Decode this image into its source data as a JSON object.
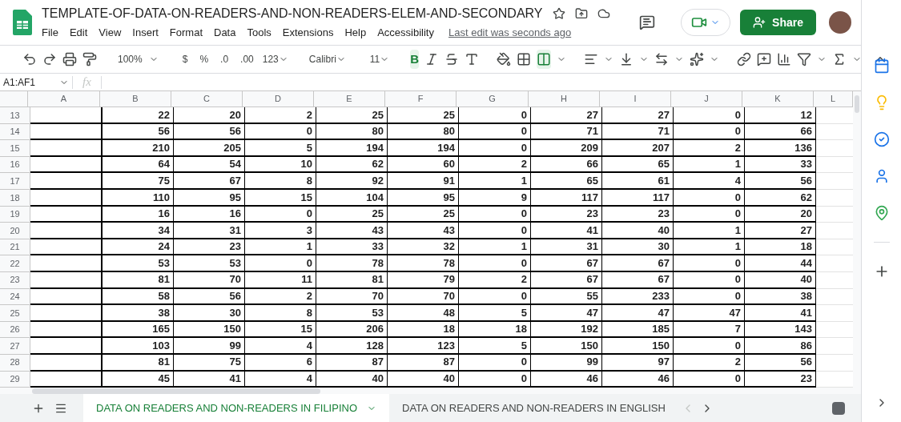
{
  "document": {
    "title": "TEMPLATE-OF-DATA-ON-READERS-AND-NON-READERS-ELEM-AND-SECONDARY",
    "last_edit": "Last edit was seconds ago",
    "share": "Share"
  },
  "menu": [
    "File",
    "Edit",
    "View",
    "Insert",
    "Format",
    "Data",
    "Tools",
    "Extensions",
    "Help",
    "Accessibility"
  ],
  "toolbar": {
    "zoom": "100%",
    "currency": "$",
    "percent": "%",
    "decrease_decimals": ".0",
    "increase_decimals": ".00",
    "number_format": "123",
    "font": "Calibri",
    "font_size": "11",
    "bold": "B",
    "bold_active": true,
    "merge_active": true
  },
  "formula_bar": {
    "name_box": "A1:AF1",
    "fx": "fx"
  },
  "columns": [
    "A",
    "B",
    "C",
    "D",
    "E",
    "F",
    "G",
    "H",
    "I",
    "J",
    "K",
    "L"
  ],
  "rows": [
    {
      "number": "13",
      "cells": [
        "22",
        "20",
        "2",
        "25",
        "25",
        "0",
        "27",
        "27",
        "0",
        "12"
      ]
    },
    {
      "number": "14",
      "cells": [
        "56",
        "56",
        "0",
        "80",
        "80",
        "0",
        "71",
        "71",
        "0",
        "66"
      ]
    },
    {
      "number": "15",
      "cells": [
        "210",
        "205",
        "5",
        "194",
        "194",
        "0",
        "209",
        "207",
        "2",
        "136"
      ]
    },
    {
      "number": "16",
      "cells": [
        "64",
        "54",
        "10",
        "62",
        "60",
        "2",
        "66",
        "65",
        "1",
        "33"
      ]
    },
    {
      "number": "17",
      "cells": [
        "75",
        "67",
        "8",
        "92",
        "91",
        "1",
        "65",
        "61",
        "4",
        "56"
      ]
    },
    {
      "number": "18",
      "cells": [
        "110",
        "95",
        "15",
        "104",
        "95",
        "9",
        "117",
        "117",
        "0",
        "62"
      ]
    },
    {
      "number": "19",
      "cells": [
        "16",
        "16",
        "0",
        "25",
        "25",
        "0",
        "23",
        "23",
        "0",
        "20"
      ]
    },
    {
      "number": "20",
      "cells": [
        "34",
        "31",
        "3",
        "43",
        "43",
        "0",
        "41",
        "40",
        "1",
        "27"
      ]
    },
    {
      "number": "21",
      "cells": [
        "24",
        "23",
        "1",
        "33",
        "32",
        "1",
        "31",
        "30",
        "1",
        "18"
      ]
    },
    {
      "number": "22",
      "cells": [
        "53",
        "53",
        "0",
        "78",
        "78",
        "0",
        "67",
        "67",
        "0",
        "44"
      ]
    },
    {
      "number": "23",
      "cells": [
        "81",
        "70",
        "11",
        "81",
        "79",
        "2",
        "67",
        "67",
        "0",
        "40"
      ]
    },
    {
      "number": "24",
      "cells": [
        "58",
        "56",
        "2",
        "70",
        "70",
        "0",
        "55",
        "233",
        "0",
        "38"
      ]
    },
    {
      "number": "25",
      "cells": [
        "38",
        "30",
        "8",
        "53",
        "48",
        "5",
        "47",
        "47",
        "47",
        "41"
      ]
    },
    {
      "number": "26",
      "cells": [
        "165",
        "150",
        "15",
        "206",
        "18",
        "18",
        "192",
        "185",
        "7",
        "143"
      ]
    },
    {
      "number": "27",
      "cells": [
        "103",
        "99",
        "4",
        "128",
        "123",
        "5",
        "150",
        "150",
        "0",
        "86"
      ]
    },
    {
      "number": "28",
      "cells": [
        "81",
        "75",
        "6",
        "87",
        "87",
        "0",
        "99",
        "97",
        "2",
        "56"
      ]
    },
    {
      "number": "29",
      "cells": [
        "45",
        "41",
        "4",
        "40",
        "40",
        "0",
        "46",
        "46",
        "0",
        "23"
      ]
    }
  ],
  "sheet_tabs": [
    {
      "label": "DATA ON READERS AND NON-READERS IN FILIPINO",
      "selected": true
    },
    {
      "label": "DATA ON READERS AND NON-READERS IN ENGLISH",
      "selected": false
    }
  ]
}
